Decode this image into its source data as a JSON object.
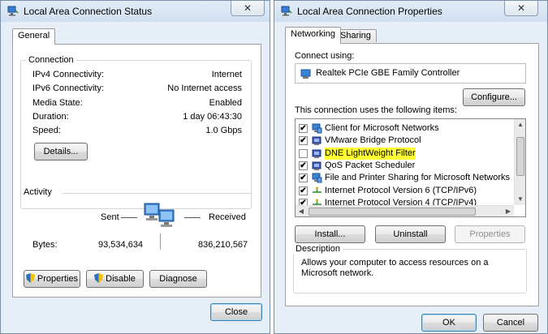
{
  "status_window": {
    "title": "Local Area Connection Status",
    "close_glyph": "✕",
    "tab": "General",
    "connection_label": "Connection",
    "rows": [
      {
        "label": "IPv4 Connectivity:",
        "value": "Internet"
      },
      {
        "label": "IPv6 Connectivity:",
        "value": "No Internet access"
      },
      {
        "label": "Media State:",
        "value": "Enabled"
      },
      {
        "label": "Duration:",
        "value": "1 day 06:43:30"
      },
      {
        "label": "Speed:",
        "value": "1.0 Gbps"
      }
    ],
    "details_button": "Details...",
    "activity_label": "Activity",
    "sent_label": "Sent",
    "received_label": "Received",
    "bytes_label": "Bytes:",
    "bytes_sent": "93,534,634",
    "bytes_received": "836,210,567",
    "properties_button": "Properties",
    "disable_button": "Disable",
    "diagnose_button": "Diagnose",
    "close_button": "Close"
  },
  "properties_window": {
    "title": "Local Area Connection Properties",
    "close_glyph": "✕",
    "tabs": [
      "Networking",
      "Sharing"
    ],
    "connect_using_label": "Connect using:",
    "adapter": "Realtek PCIe GBE Family Controller",
    "configure_button": "Configure...",
    "items_label": "This connection uses the following items:",
    "items": [
      {
        "label": "Client for Microsoft Networks",
        "checked": true,
        "icon": "network-client-icon"
      },
      {
        "label": "VMware Bridge Protocol",
        "checked": true,
        "icon": "network-service-icon"
      },
      {
        "label": "DNE LightWeight Filter",
        "checked": false,
        "icon": "network-service-icon",
        "highlighted": true
      },
      {
        "label": "QoS Packet Scheduler",
        "checked": true,
        "icon": "network-service-icon"
      },
      {
        "label": "File and Printer Sharing for Microsoft Networks",
        "checked": true,
        "icon": "network-client-icon"
      },
      {
        "label": "Internet Protocol Version 6 (TCP/IPv6)",
        "checked": true,
        "icon": "protocol-icon"
      },
      {
        "label": "Internet Protocol Version 4 (TCP/IPv4)",
        "checked": true,
        "icon": "protocol-icon"
      }
    ],
    "install_button": "Install...",
    "uninstall_button": "Uninstall",
    "properties_button": "Properties",
    "description_label": "Description",
    "description_text": "Allows your computer to access resources on a Microsoft network.",
    "ok_button": "OK",
    "cancel_button": "Cancel"
  },
  "colors": {
    "highlight": "#ffff33",
    "titlebar": "#dbe7f4",
    "frame": "#e6eef8"
  }
}
